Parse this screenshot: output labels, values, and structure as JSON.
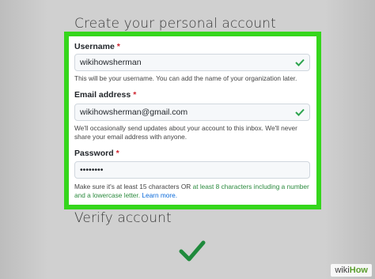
{
  "page": {
    "create_title": "Create your personal account",
    "verify_title": "Verify account"
  },
  "form": {
    "username": {
      "label": "Username",
      "required_mark": "*",
      "value": "wikihowsherman",
      "note": "This will be your username. You can add the name of your organization later."
    },
    "email": {
      "label": "Email address",
      "required_mark": "*",
      "value": "wikihowsherman@gmail.com",
      "note": "We'll occasionally send updates about your account to this inbox. We'll never share your email address with anyone."
    },
    "password": {
      "label": "Password",
      "required_mark": "*",
      "value": "••••••••",
      "note_part1": "Make sure it's at least 15 characters OR ",
      "note_part2": "at least 8 characters including a number and a lowercase letter.",
      "note_link": "Learn more."
    }
  },
  "watermark": {
    "wiki": "wiki",
    "how": "How"
  },
  "colors": {
    "highlight": "#35d61c",
    "check": "#2da44e",
    "big_check": "#1f8a3c"
  }
}
